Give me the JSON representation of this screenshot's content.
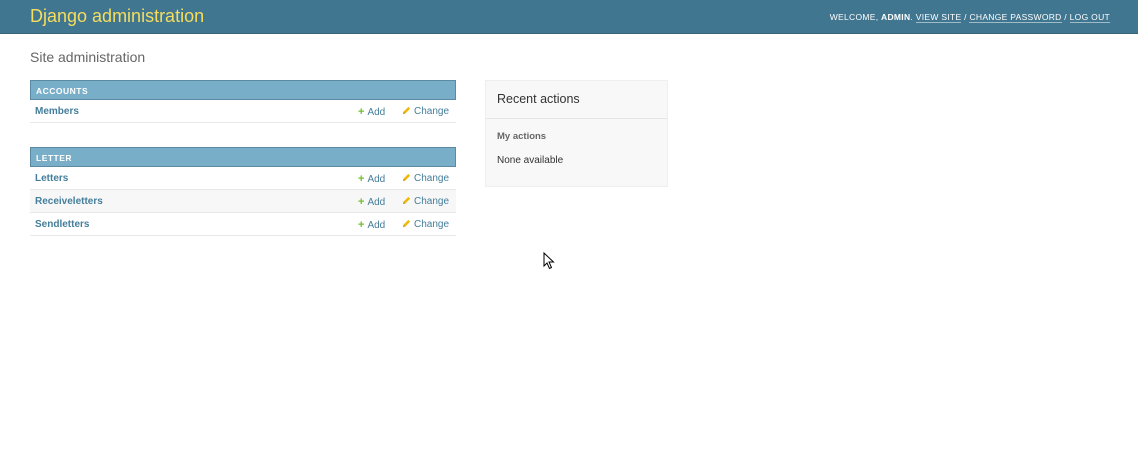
{
  "header": {
    "branding": "Django administration",
    "welcome_text": "WELCOME,",
    "username": "ADMIN",
    "view_site": "VIEW SITE",
    "separator": "/",
    "change_password": "CHANGE PASSWORD",
    "log_out": "LOG OUT"
  },
  "page_title": "Site administration",
  "modules": [
    {
      "caption": "ACCOUNTS",
      "models": [
        {
          "name": "Members",
          "add": "Add",
          "change": "Change"
        }
      ]
    },
    {
      "caption": "LETTER",
      "models": [
        {
          "name": "Letters",
          "add": "Add",
          "change": "Change"
        },
        {
          "name": "Receiveletters",
          "add": "Add",
          "change": "Change"
        },
        {
          "name": "Sendletters",
          "add": "Add",
          "change": "Change"
        }
      ]
    }
  ],
  "recent_actions": {
    "title": "Recent actions",
    "subtitle": "My actions",
    "empty_text": "None available"
  },
  "colors": {
    "header_bg": "#417690",
    "branding": "#f5dd5d",
    "caption_bg": "#79aec8",
    "link": "#447e9b",
    "add_icon": "#70bf2b",
    "change_icon": "#efb80b"
  },
  "icons": {
    "add": "plus-icon",
    "change": "pencil-icon",
    "pointer": "mouse-cursor-icon"
  }
}
